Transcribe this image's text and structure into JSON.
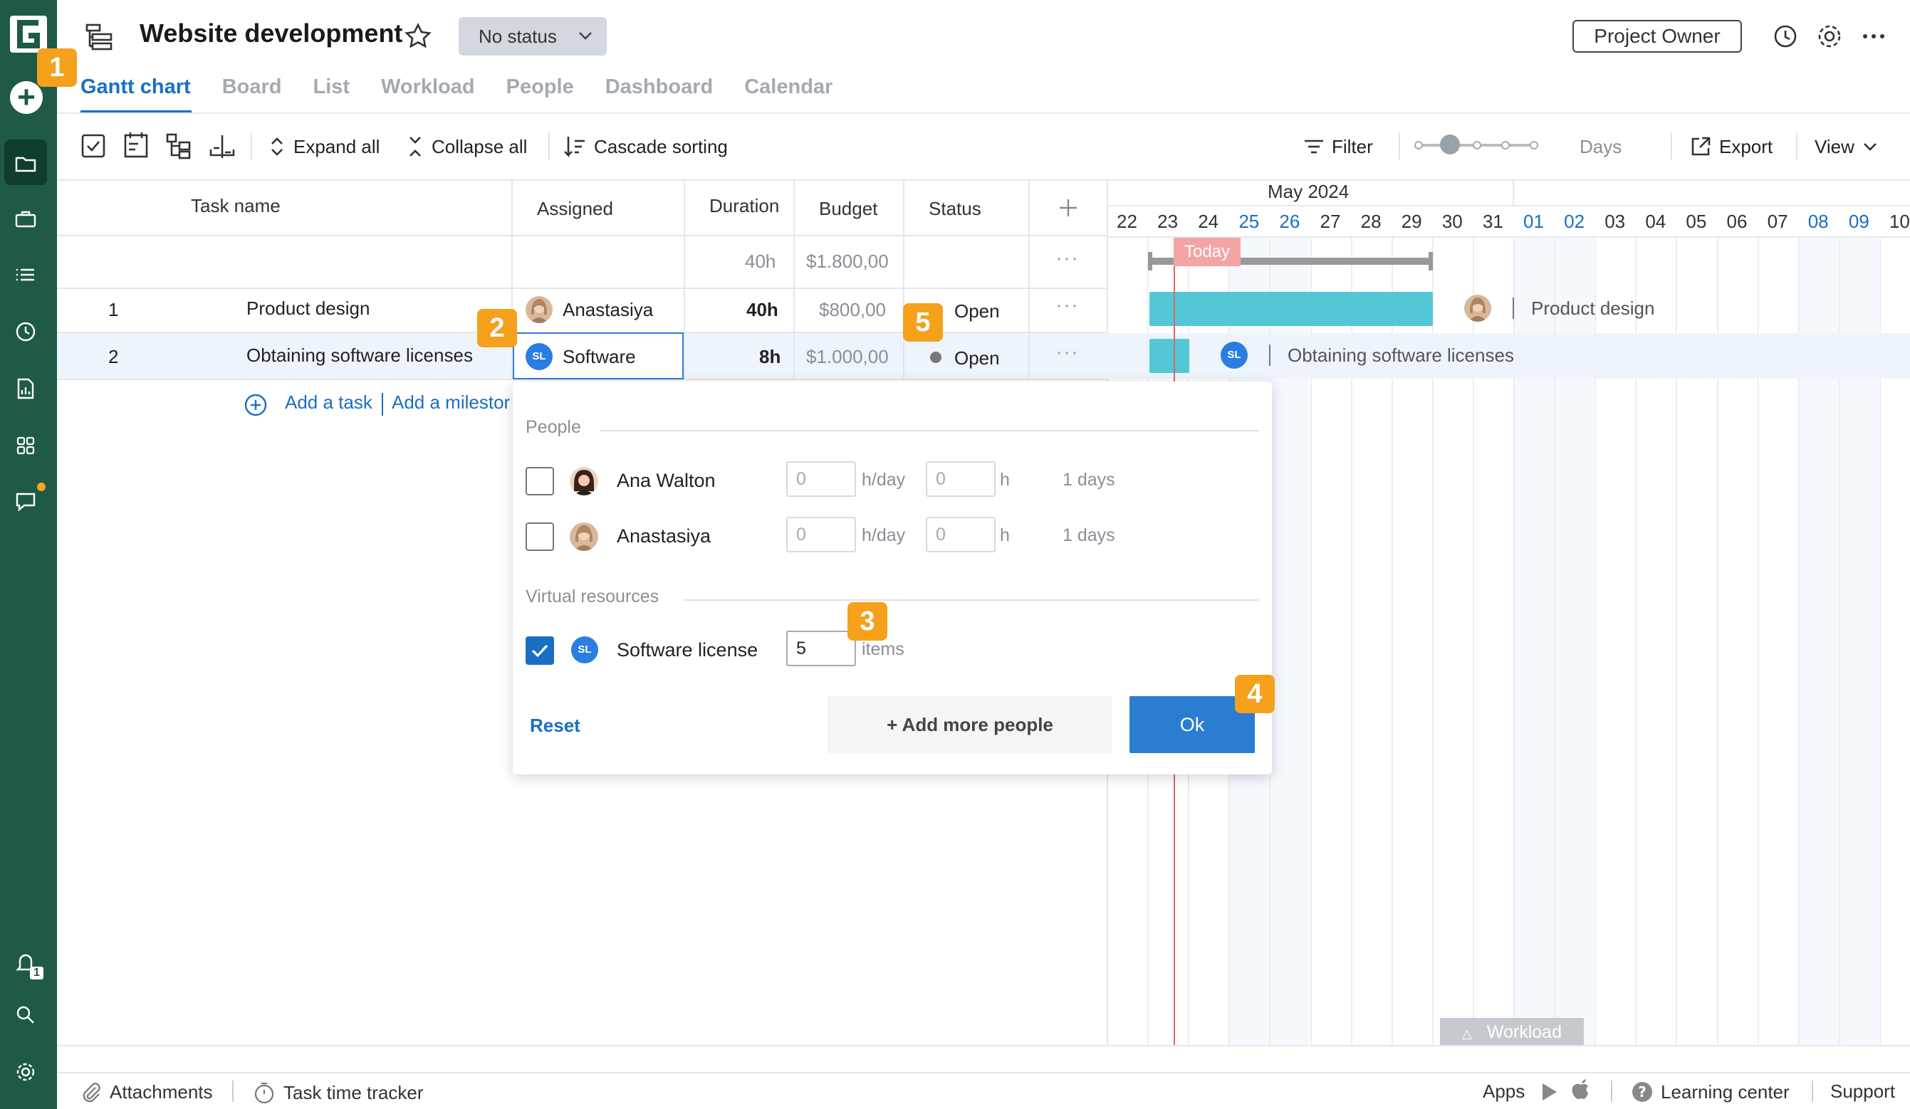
{
  "header": {
    "title": "Website development",
    "status": "No status",
    "role_button": "Project Owner"
  },
  "tabs": [
    {
      "label": "Gantt chart",
      "active": true
    },
    {
      "label": "Board"
    },
    {
      "label": "List"
    },
    {
      "label": "Workload"
    },
    {
      "label": "People"
    },
    {
      "label": "Dashboard"
    },
    {
      "label": "Calendar"
    }
  ],
  "toolbar": {
    "expand_all": "Expand all",
    "collapse_all": "Collapse all",
    "cascade_sorting": "Cascade sorting",
    "filter": "Filter",
    "zoom_unit": "Days",
    "export": "Export",
    "view": "View"
  },
  "table": {
    "columns": {
      "task_name": "Task name",
      "assigned": "Assigned",
      "duration": "Duration",
      "budget": "Budget",
      "status": "Status"
    },
    "summary": {
      "duration": "40h",
      "budget": "$1.800,00"
    },
    "rows": [
      {
        "num": "1",
        "name": "Product design",
        "assigned": "Anastasiya",
        "duration": "40h",
        "budget": "$800,00",
        "status": "Open"
      },
      {
        "num": "2",
        "name": "Obtaining software licenses",
        "assigned": "Software",
        "assigned_initials": "SL",
        "duration": "8h",
        "budget": "$1.000,00",
        "status": "Open"
      }
    ],
    "add_task": "Add a task",
    "add_milestone": "Add a milestor"
  },
  "gantt": {
    "month": "May 2024",
    "days": [
      "22",
      "23",
      "24",
      "25",
      "26",
      "27",
      "28",
      "29",
      "30",
      "31",
      "01",
      "02",
      "03",
      "04",
      "05",
      "06",
      "07",
      "08",
      "09",
      "10"
    ],
    "weekend_days": [
      "25",
      "26",
      "01",
      "02",
      "08",
      "09"
    ],
    "today_label": "Today",
    "bar_labels": [
      "Product design",
      "Obtaining software licenses"
    ],
    "workload_tab": "Workload"
  },
  "popup": {
    "people_section": "People",
    "people": [
      {
        "name": "Ana Walton",
        "per_day": "0",
        "per_day_unit": "h/day",
        "hours": "0",
        "hours_unit": "h",
        "days": "1 days",
        "checked": false
      },
      {
        "name": "Anastasiya",
        "per_day": "0",
        "per_day_unit": "h/day",
        "hours": "0",
        "hours_unit": "h",
        "days": "1 days",
        "checked": false
      }
    ],
    "virtual_section": "Virtual resources",
    "virtual": [
      {
        "name": "Software license",
        "initials": "SL",
        "qty": "5",
        "unit": "items",
        "checked": true
      }
    ],
    "reset": "Reset",
    "add_more": "+ Add more people",
    "ok": "Ok"
  },
  "callouts": [
    "1",
    "2",
    "3",
    "4",
    "5"
  ],
  "footer": {
    "attachments": "Attachments",
    "time_tracker": "Task time tracker",
    "apps": "Apps",
    "learning": "Learning center",
    "support": "Support"
  },
  "notifications_count": "1",
  "colors": {
    "rail": "#1e5a47",
    "accent": "#1a6fc2",
    "bar": "#54c7d6",
    "today": "#e06666",
    "callout": "#f5a11c"
  }
}
